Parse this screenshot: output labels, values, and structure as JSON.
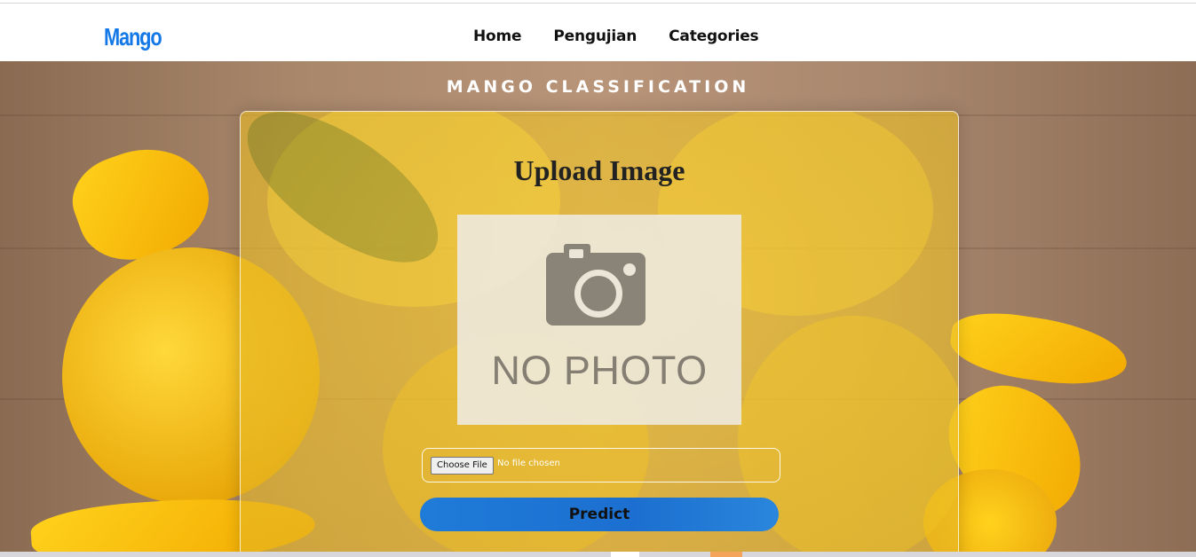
{
  "navbar": {
    "brand": "Mango",
    "links": [
      "Home",
      "Pengujian",
      "Categories"
    ]
  },
  "hero": {
    "title": "MANGO CLASSIFICATION"
  },
  "upload_card": {
    "title": "Upload Image",
    "placeholder_image_text": "NO PHOTO",
    "file_input": {
      "button_label": "Choose File",
      "status_text": "No file chosen"
    },
    "predict_label": "Predict"
  },
  "colors": {
    "brand": "#1479e6",
    "predict_button": "#1c6fd0",
    "card_tint": "#ebbe28"
  },
  "icons": {
    "placeholder": "camera-icon"
  }
}
